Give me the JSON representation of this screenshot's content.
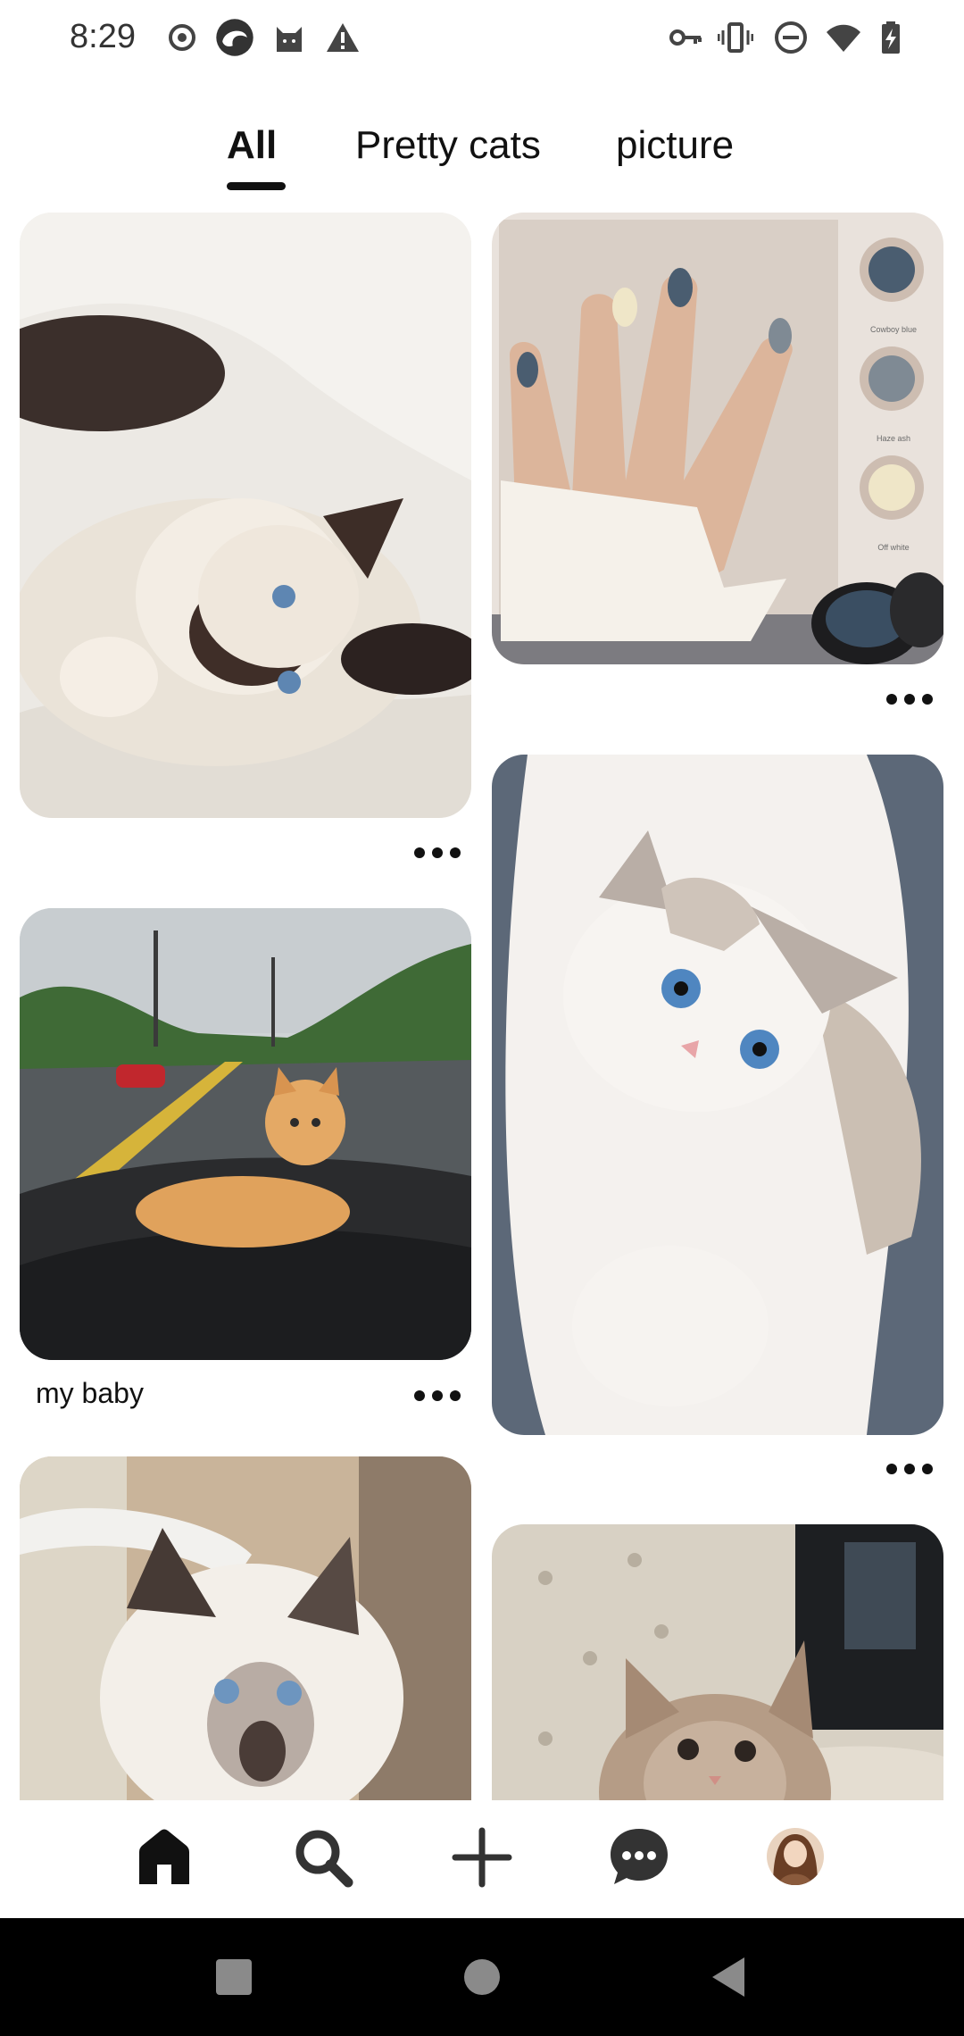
{
  "status_bar": {
    "time": "8:29",
    "left_icons": [
      "record-icon",
      "edge-browser-icon",
      "cat-app-icon",
      "warning-icon"
    ],
    "right_icons": [
      "vpn-key-icon",
      "vibrate-icon",
      "do-not-disturb-icon",
      "wifi-icon",
      "battery-charging-icon"
    ]
  },
  "tabs": [
    {
      "label": "All",
      "active": true
    },
    {
      "label": "Pretty cats",
      "active": false
    },
    {
      "label": "picture",
      "active": false
    }
  ],
  "pins": [
    {
      "id": "ragdoll-kitten-on-blanket",
      "caption": ""
    },
    {
      "id": "nail-color-swatches",
      "caption": ""
    },
    {
      "id": "kitten-on-dashboard",
      "caption": "my baby"
    },
    {
      "id": "fluffy-white-cat",
      "caption": ""
    },
    {
      "id": "birman-kitten",
      "caption": ""
    },
    {
      "id": "tabby-kitten-on-sofa",
      "caption": ""
    }
  ],
  "nail_swatch_labels": [
    "Cowboy blue",
    "Haze ash",
    "Off white"
  ],
  "bottom_nav": [
    "home-icon",
    "search-icon",
    "create-plus-icon",
    "messages-icon",
    "profile-avatar"
  ],
  "system_nav": [
    "recents-icon",
    "home-circle-icon",
    "back-icon"
  ],
  "colors": {
    "accent": "#111111",
    "background": "#ffffff"
  }
}
